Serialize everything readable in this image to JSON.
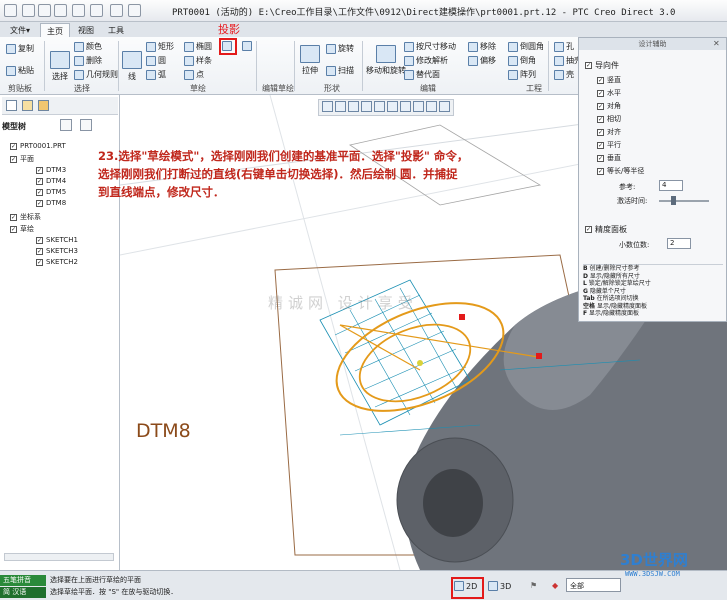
{
  "window": {
    "title": "PRT0001 (活动的) E:\\Creo工作目录\\工作文件\\0912\\Direct建模操作\\prt0001.prt.12 - PTC Creo Direct 3.0"
  },
  "ribbon": {
    "tabs": [
      "文件▾",
      "主页",
      "视图",
      "工具"
    ],
    "clipboard": {
      "copy": "复制",
      "paste": "粘贴",
      "label": "剪贴板"
    },
    "select": {
      "color": "颜色",
      "delete": "删除",
      "select_label": "选择",
      "geometry_rules": "几何规则",
      "label": "选择"
    },
    "sketch": {
      "line": "线",
      "rectangle": "矩形",
      "circle": "圆",
      "arc": "弧",
      "ellipse": "椭圆",
      "spline": "样条",
      "point": "点",
      "label": "草绘"
    },
    "edit_sketch": {
      "label": "编辑草绘"
    },
    "shape": {
      "extrude": "拉伸",
      "revolve": "旋转",
      "sweep": "扫描",
      "label": "形状"
    },
    "edit": {
      "move_rotate": "移动和旋转",
      "move_by_dim": "按尺寸移动",
      "modify_analysis": "修改解析",
      "replace": "替代面",
      "move": "移除",
      "offset": "偏移",
      "pattern": "阵列",
      "round": "倒圆角",
      "chamfer": "倒角",
      "label": "编辑"
    },
    "engineering": {
      "hole": "孔",
      "shell": "抽壳",
      "shell2": "壳",
      "label": "工程"
    }
  },
  "callout": {
    "projection": "投影"
  },
  "instruction": {
    "line1": "23.选择\"草绘模式\"，选择刚刚我们创建的基准平面．选择\"投影\" 命令，",
    "line2": "选择刚刚我们打断过的直线(右键单击切换选择)．然后绘制 圆．并捕捉",
    "line3": "到直线端点，修改尺寸．"
  },
  "model_tree": {
    "title": "模型树",
    "items": [
      "PRT0001.PRT",
      "平面",
      "DTM3",
      "DTM4",
      "DTM5",
      "DTM8",
      "坐标系",
      "草绘",
      "SKETCH1",
      "SKETCH3",
      "SKETCH2"
    ]
  },
  "design_panel": {
    "title": "设计辅助",
    "guide_label": "导向件",
    "options": [
      "竖直",
      "水平",
      "对角",
      "相切",
      "对齐",
      "平行",
      "垂直",
      "等长/等半径"
    ],
    "ref_label": "参考:",
    "ref_value": "4",
    "snap_label": "激活时间:",
    "precision_panel": "精度面板",
    "decimals_label": "小数位数:",
    "decimals_value": "2",
    "shortcuts": [
      {
        "key": "B",
        "text": "创建/删除尺寸参考"
      },
      {
        "key": "D",
        "text": "显示/隐藏所有尺寸"
      },
      {
        "key": "L",
        "text": "锁定/解除锁定草绘尺寸"
      },
      {
        "key": "G",
        "text": "隐藏单个尺寸"
      },
      {
        "key": "Tab",
        "text": "在所选项间切换"
      },
      {
        "key": "空格",
        "text": "显示/隐藏精度面板"
      },
      {
        "key": "F",
        "text": "显示/隐藏精度面板"
      }
    ]
  },
  "viewport": {
    "datum_label": "DTM8",
    "watermark": "精诚网 设计享受"
  },
  "status": {
    "mode_label": "五笔拼音",
    "mode_sub": "简 汉语",
    "message1": "选择要在上面进行草绘的平面",
    "message2": "选择草绘平面．按 \"S\" 在放与驱动切换．",
    "mode_2d": "2D",
    "mode_3d": "3D",
    "filter": "全部"
  },
  "logo": {
    "text": "3D世界网",
    "sub": "WWW.3DSJW.COM"
  },
  "colors": {
    "accent_red": "#e31a1a",
    "sketch_orange": "#e49a1a",
    "instruction_red": "#c0271c",
    "mesh_blue": "#1a8fb3",
    "part_gray": "#6f747c"
  }
}
